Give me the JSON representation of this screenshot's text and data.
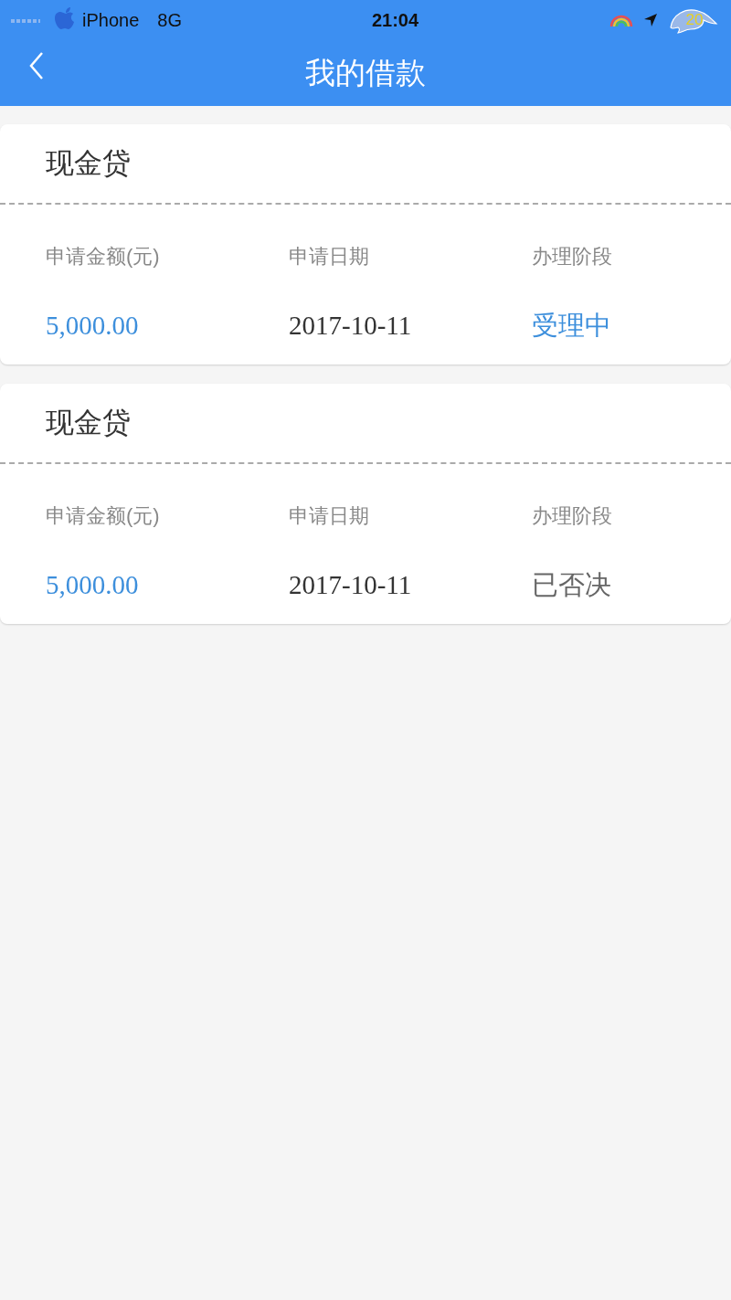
{
  "status_bar": {
    "carrier": "iPhone",
    "network": "8G",
    "time": "21:04",
    "badge": "20"
  },
  "nav_bar": {
    "title": "我的借款"
  },
  "loans": [
    {
      "title": "现金贷",
      "columns": [
        {
          "label": "申请金额(元)",
          "value": "5,000.00",
          "color": "#3d8fdc"
        },
        {
          "label": "申请日期",
          "value": "2017-10-11",
          "color": "#333333"
        },
        {
          "label": "办理阶段",
          "value": "受理中",
          "color": "#3d8fdc"
        }
      ]
    },
    {
      "title": "现金贷",
      "columns": [
        {
          "label": "申请金额(元)",
          "value": "5,000.00",
          "color": "#3d8fdc"
        },
        {
          "label": "申请日期",
          "value": "2017-10-11",
          "color": "#333333"
        },
        {
          "label": "办理阶段",
          "value": "已否决",
          "color": "#666666"
        }
      ]
    }
  ]
}
